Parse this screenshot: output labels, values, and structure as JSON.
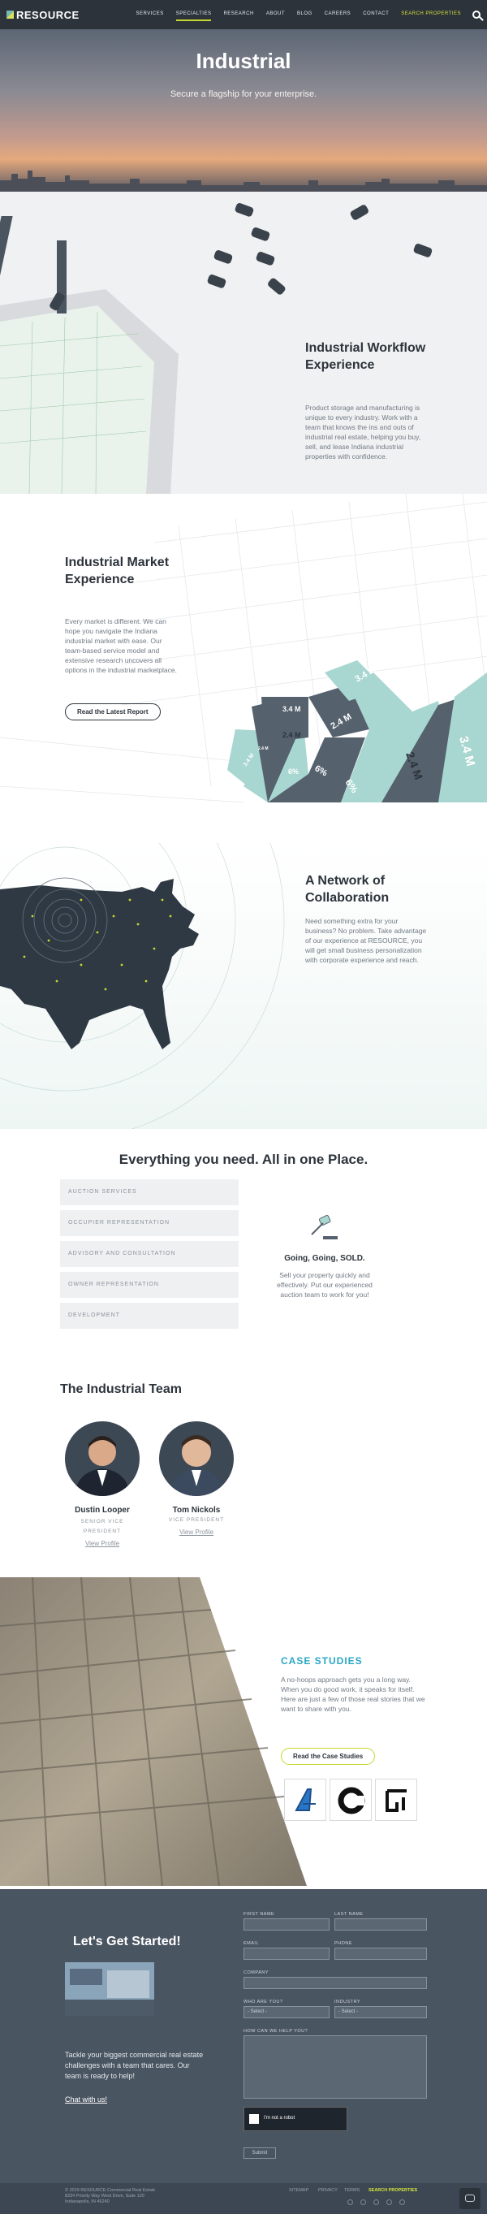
{
  "nav": {
    "brand": "RESOURCE",
    "items": [
      "SERVICES",
      "SPECIALTIES",
      "RESEARCH",
      "ABOUT",
      "BLOG",
      "CAREERS",
      "CONTACT",
      "SEARCH PROPERTIES"
    ]
  },
  "hero": {
    "title": "Industrial",
    "subtitle": "Secure a flagship for your enterprise."
  },
  "workflow": {
    "title": "Industrial Workflow Experience",
    "body": "Product storage and manufacturing is unique to every industry. Work with a team that knows the ins and outs of industrial real estate, helping you buy, sell, and lease Indiana industrial properties with confidence."
  },
  "market": {
    "title": "Industrial Market Experience",
    "body": "Every market is different. We can hope you navigate the Indiana industrial market with ease. Our team-based service model and extensive research uncovers all options in the industrial marketplace.",
    "button": "Read the Latest Report",
    "chart_labels": [
      "3.4 M",
      "3.4 M",
      "2.4 M",
      "2.4 M",
      "3.4 M",
      "6%",
      "6%",
      "6%",
      "2.4 M",
      "3.4 M",
      "2.4 M"
    ]
  },
  "network": {
    "title": "A Network of Collaboration",
    "body": "Need something extra for your business? No problem. Take advantage of our experience at RESOURCE, you will get small business personalization with corporate experience and reach."
  },
  "services": {
    "heading": "Everything you need. All in one Place.",
    "items": [
      "AUCTION SERVICES",
      "OCCUPIER REPRESENTATION",
      "ADVISORY AND CONSULTATION",
      "OWNER REPRESENTATION",
      "DEVELOPMENT"
    ],
    "feature_title": "Going, Going, SOLD.",
    "feature_body": "Sell your property quickly and effectively. Put our experienced auction team to work for you!"
  },
  "team": {
    "heading": "The Industrial Team",
    "members": [
      {
        "name": "Dustin Looper",
        "role": "SENIOR VICE PRESIDENT",
        "link": "View Profile"
      },
      {
        "name": "Tom Nickols",
        "role": "VICE PRESIDENT",
        "link": "View Profile"
      }
    ]
  },
  "cases": {
    "title": "CASE STUDIES",
    "body": "A no-hoops approach gets you a long way. When you do good work, it speaks for itself. Here are just a few of those real stories that we want to share with you.",
    "button": "Read the Case Studies"
  },
  "contact": {
    "title": "Let's Get Started!",
    "body": "Tackle your biggest commercial real estate challenges with a team that cares. Our team is ready to help!",
    "link": "Chat with us!",
    "labels": {
      "first_name": "FIRST NAME",
      "last_name": "LAST NAME",
      "email": "EMAIL",
      "phone": "PHONE",
      "company": "COMPANY",
      "who": "WHO ARE YOU?",
      "industry": "INDUSTRY",
      "help": "HOW CAN WE HELP YOU?"
    },
    "select_placeholder": "- Select -",
    "captcha": "I'm not a robot",
    "submit": "Submit"
  },
  "footer": {
    "copyright": "© 2019 RESOURCE Commercial Real Estate",
    "address1": "8334 Priority Way West Drive, Suite 120",
    "address2": "Indianapolis, IN 46240",
    "links": [
      "SITEMAP",
      "PRIVACY",
      "TERMS"
    ],
    "cta": "SEARCH PROPERTIES"
  },
  "colors": {
    "accent": "#c9d82e",
    "teal": "#a8d6d0",
    "dark": "#2c333b",
    "case_blue": "#2aa6c6"
  }
}
